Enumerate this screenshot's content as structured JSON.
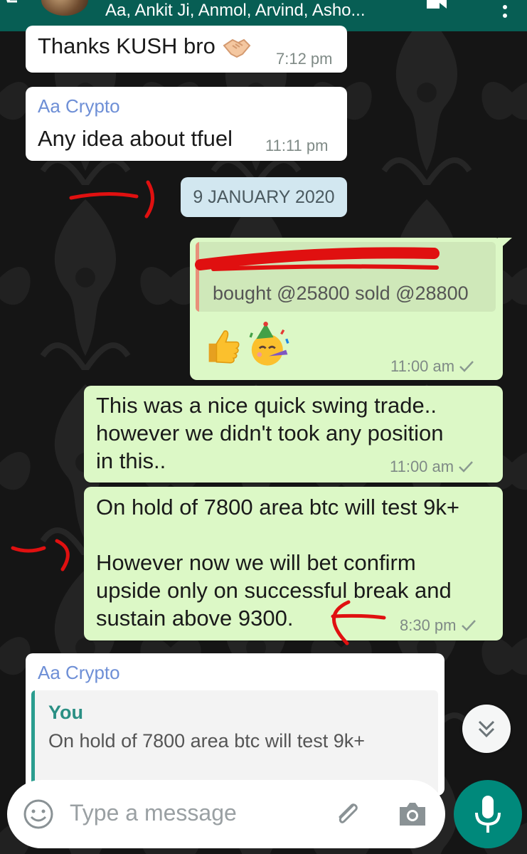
{
  "header": {
    "title": "Aa, Ankit Ji, Anmol, Arvind, Asho...",
    "color": "#075e54"
  },
  "messages": [
    {
      "type": "incoming",
      "text": "Thanks KUSH bro",
      "time": "7:12 pm"
    },
    {
      "type": "incoming",
      "sender": "Aa Crypto",
      "text": "Any idea about tfuel",
      "time": "11:11 pm"
    },
    {
      "type": "outgoing",
      "quote_text": "bought @25800 sold @28800",
      "time": "11:00 am"
    },
    {
      "type": "outgoing",
      "text": "This was a nice quick swing trade..\nhowever we didn't took any position\nin this..",
      "time": "11:00 am"
    },
    {
      "type": "outgoing",
      "text": "On hold of 7800 area btc will test 9k+\n\nHowever now we will bet confirm\nupside only on successful break and\nsustain above 9300.",
      "time": "8:30 pm"
    },
    {
      "type": "incoming",
      "sender": "Aa Crypto",
      "quote_author": "You",
      "quote_text": "On hold of 7800 area btc will test 9k+"
    }
  ],
  "date_divider": "9 JANUARY 2020",
  "composer": {
    "placeholder": "Type a message",
    "icons": [
      "emoji-icon",
      "attach-icon",
      "camera-icon",
      "mic-icon"
    ]
  },
  "colors": {
    "outgoing_bubble": "#dcf8c6",
    "incoming_bubble": "#ffffff",
    "sender_name": "#6e8fd6",
    "annotation_red": "#e01010",
    "mic_button": "#00897b"
  }
}
